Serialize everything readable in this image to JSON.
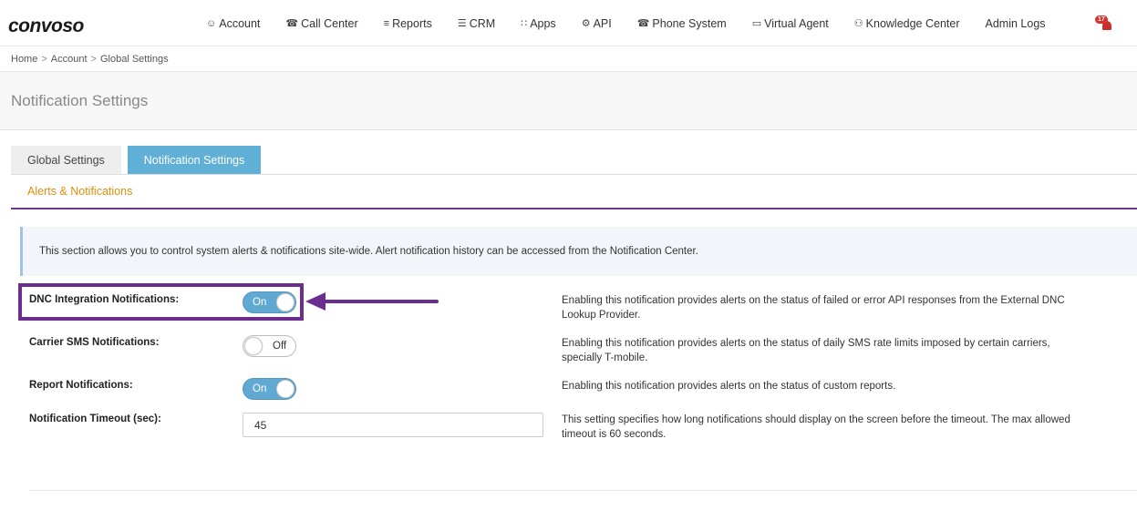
{
  "brand": {
    "logo_text": "convoso"
  },
  "nav": [
    {
      "label": "Account",
      "icon": "user-icon",
      "glyph": "☺"
    },
    {
      "label": "Call Center",
      "icon": "phone-icon",
      "glyph": "☎"
    },
    {
      "label": "Reports",
      "icon": "bar-chart-icon",
      "glyph": "≡"
    },
    {
      "label": "CRM",
      "icon": "list-icon",
      "glyph": "☰"
    },
    {
      "label": "Apps",
      "icon": "grid-icon",
      "glyph": "∷"
    },
    {
      "label": "API",
      "icon": "gear-icon",
      "glyph": "⚙"
    },
    {
      "label": "Phone System",
      "icon": "phone-icon",
      "glyph": "☎"
    },
    {
      "label": "Virtual Agent",
      "icon": "monitor-icon",
      "glyph": "▭"
    },
    {
      "label": "Knowledge Center",
      "icon": "lightbulb-icon",
      "glyph": "⚇"
    },
    {
      "label": "Admin Logs",
      "icon": "",
      "glyph": ""
    }
  ],
  "notifications": {
    "badge": "17"
  },
  "breadcrumb": {
    "home": "Home",
    "account": "Account",
    "current": "Global Settings",
    "sep": ">"
  },
  "page": {
    "title": "Notification Settings"
  },
  "tabs": {
    "global": "Global Settings",
    "notification": "Notification Settings"
  },
  "section": {
    "subheading": "Alerts & Notifications",
    "info": "This section allows you to control system alerts & notifications site-wide. Alert notification history can be accessed from the Notification Center."
  },
  "settings": {
    "dnc": {
      "label": "DNC Integration Notifications:",
      "state": "On",
      "desc": "Enabling this notification provides alerts on the status of failed or error API responses from the External DNC Lookup Provider."
    },
    "carrier": {
      "label": "Carrier SMS Notifications:",
      "state": "Off",
      "desc": "Enabling this notification provides alerts on the status of daily SMS rate limits imposed by certain carriers, specially T-mobile."
    },
    "report": {
      "label": "Report Notifications:",
      "state": "On",
      "desc": "Enabling this notification provides alerts on the status of custom reports."
    },
    "timeout": {
      "label": "Notification Timeout (sec):",
      "value": "45",
      "desc": "This setting specifies how long notifications should display on the screen before the timeout. The max allowed timeout is 60 seconds."
    }
  },
  "colors": {
    "accent": "#5fafd6",
    "highlight": "#6b2e8e",
    "subheading": "#e08e0b"
  }
}
